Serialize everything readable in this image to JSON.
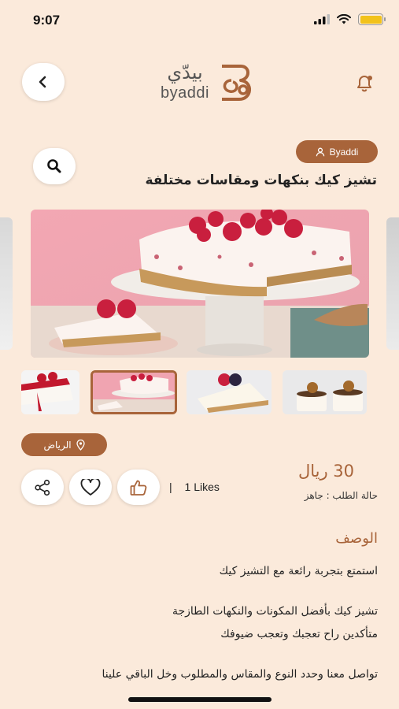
{
  "status_bar": {
    "time": "9:07"
  },
  "header": {
    "logo_ar": "بيدّي",
    "logo_en": "byaddi"
  },
  "product": {
    "author": "Byaddi",
    "title": "تشيز كيك بنكهات ومقاسات مختلفة",
    "location": "الرياض",
    "likes": "1 Likes",
    "likes_separator": "|",
    "price": "30 ريال",
    "order_status": "حالة الطلب : جاهز"
  },
  "description": {
    "heading": "الوصف",
    "lines": [
      "استمتع بتجربة رائعة مع التشيز كيك",
      "تشيز كيك بأفضل المكونات والنكهات الطازجة",
      "متأكدين راح تعجبك وتعجب ضيوفك",
      "تواصل معنا وحدد النوع والمقاس والمطلوب وخل الباقي علينا"
    ]
  },
  "icons": {
    "back": "chevron-left-icon",
    "notification": "bell-icon",
    "search": "search-icon",
    "author": "user-icon",
    "location": "map-pin-icon",
    "share": "share-icon",
    "favorite": "heart-icon",
    "like": "thumbs-up-icon"
  },
  "colors": {
    "background": "#fbeadb",
    "accent": "#a8643a",
    "button": "#ffffff"
  }
}
